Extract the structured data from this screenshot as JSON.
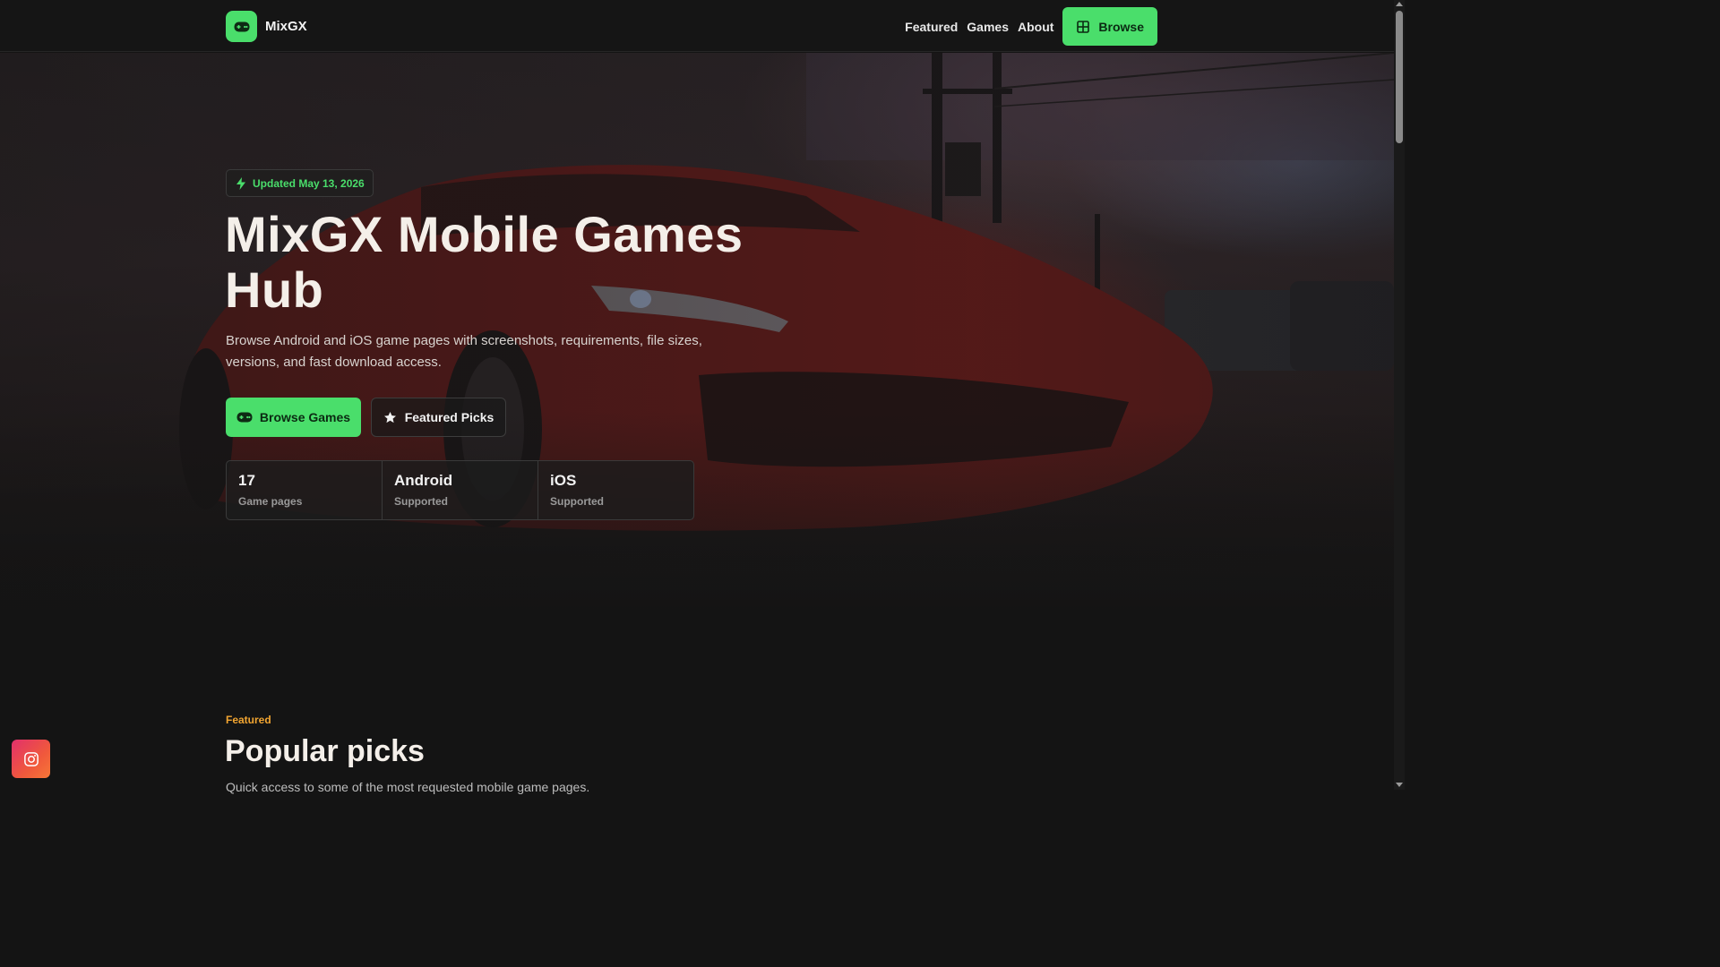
{
  "brand": {
    "name": "MixGX",
    "logo_icon": "gamepad-icon",
    "accent": "#4ade6b"
  },
  "nav": {
    "links": [
      "Featured",
      "Games",
      "About"
    ],
    "browse_label": "Browse",
    "browse_icon": "grid-icon"
  },
  "hero": {
    "badge": "Updated May 13, 2026",
    "badge_icon": "bolt-icon",
    "title": "MixGX Mobile Games Hub",
    "description": "Browse Android and iOS game pages with screenshots, requirements, file sizes, versions, and fast download access.",
    "primary_cta": "Browse Games",
    "primary_cta_icon": "gamepad-icon",
    "secondary_cta": "Featured Picks",
    "secondary_cta_icon": "star-icon",
    "stats": [
      {
        "value": "17",
        "label": "Game pages"
      },
      {
        "value": "Android",
        "label": "Supported"
      },
      {
        "value": "iOS",
        "label": "Supported"
      }
    ]
  },
  "featured": {
    "eyebrow": "Featured",
    "eyebrow_color": "#f2a531",
    "title": "Popular picks",
    "description": "Quick access to some of the most requested mobile game pages."
  },
  "social": {
    "icon": "instagram-icon"
  }
}
